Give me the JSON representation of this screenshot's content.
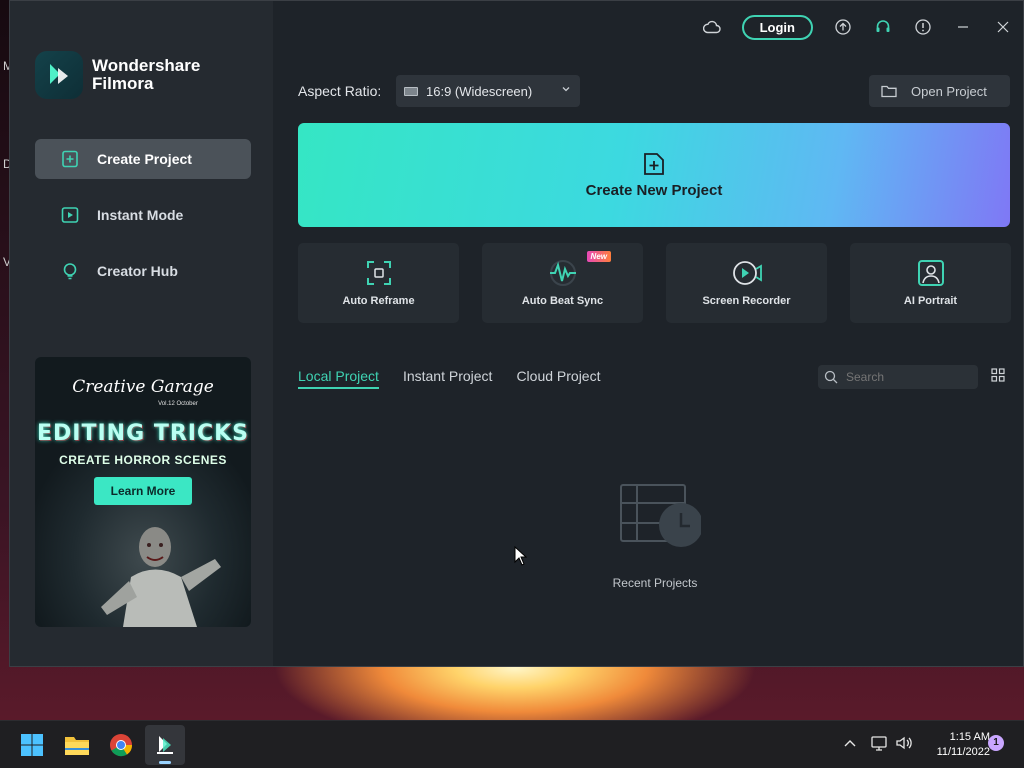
{
  "desktop": {
    "letters": [
      "M",
      "D",
      "V"
    ]
  },
  "app": {
    "brand": {
      "line1": "Wondershare",
      "line2": "Filmora"
    },
    "titlebar": {
      "login_label": "Login",
      "icons": [
        "cloud-icon",
        "upload-icon",
        "headset-icon",
        "info-icon",
        "minimize-icon",
        "close-icon"
      ]
    },
    "nav": [
      {
        "label": "Create Project",
        "icon": "create-project-icon",
        "active": true
      },
      {
        "label": "Instant Mode",
        "icon": "instant-mode-icon",
        "active": false
      },
      {
        "label": "Creator Hub",
        "icon": "lightbulb-icon",
        "active": false
      }
    ],
    "ad": {
      "script": "Creative Garage",
      "volume": "Vol.12 October",
      "title": "EDITING TRICKS",
      "subtitle": "CREATE HORROR SCENES",
      "button": "Learn More"
    },
    "aspect": {
      "label": "Aspect Ratio:",
      "value": "16:9 (Widescreen)"
    },
    "open_project_label": "Open Project",
    "create_new_label": "Create New Project",
    "tools": [
      {
        "label": "Auto Reframe",
        "icon": "reframe-icon"
      },
      {
        "label": "Auto Beat Sync",
        "icon": "beat-sync-icon",
        "badge": "New"
      },
      {
        "label": "Screen Recorder",
        "icon": "screen-recorder-icon"
      },
      {
        "label": "AI Portrait",
        "icon": "ai-portrait-icon"
      }
    ],
    "tabs": [
      "Local Project",
      "Instant Project",
      "Cloud Project"
    ],
    "active_tab": "Local Project",
    "search_placeholder": "Search",
    "empty_label": "Recent Projects",
    "accent": "#3fd3b3"
  },
  "taskbar": {
    "apps": [
      "windows-start-icon",
      "file-explorer-icon",
      "chrome-icon",
      "filmora-icon"
    ],
    "time": "1:15 AM",
    "date": "11/11/2022",
    "notification_count": "1"
  }
}
